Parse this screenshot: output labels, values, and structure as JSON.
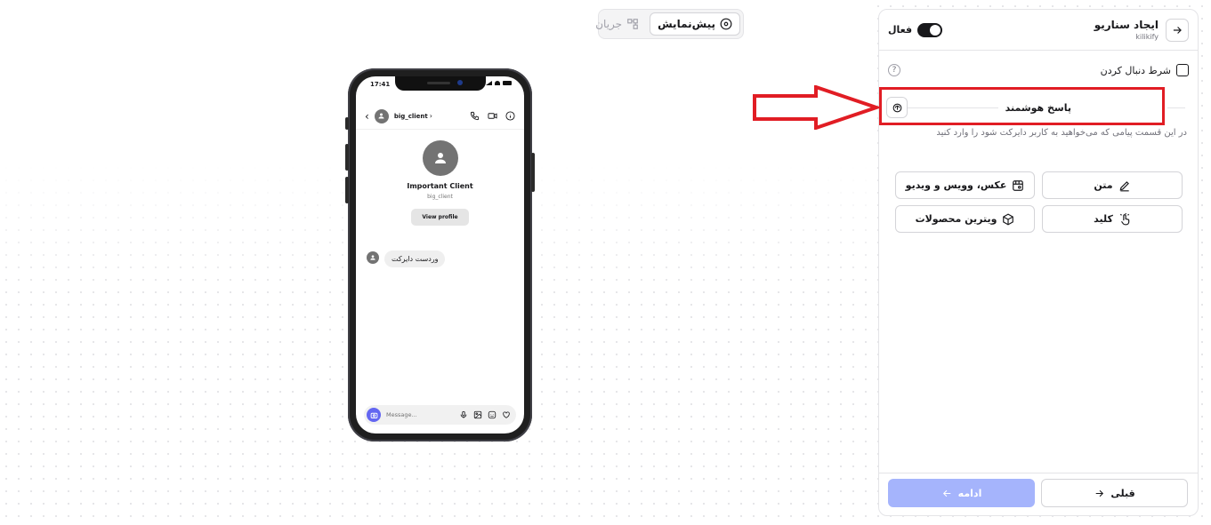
{
  "view_toggle": {
    "preview_label": "پیش‌نمایش",
    "flow_label": "جریان"
  },
  "phone": {
    "time": "17:41",
    "header_username": "big_client",
    "profile_name": "Important Client",
    "profile_username": "big_client",
    "view_profile_label": "View profile",
    "message_text": "وردست دایرکت",
    "composer_placeholder": "Message..."
  },
  "panel": {
    "title": "ایجاد سناریو",
    "subtitle": "kilikify",
    "active_label": "فعال",
    "follow_condition_label": "شرط دنبال کردن",
    "help_glyph": "?",
    "smart_reply_label": "پاسخ هوشمند",
    "description": "در این قسمت پیامی که می‌خواهید به کاربر دایرکت شود را وارد کنید",
    "options": {
      "text": "متن",
      "media": "عکس، وویس و ویدیو",
      "key": "کلید",
      "products": "ویترین محصولات"
    },
    "footer": {
      "prev_label": "قبلی",
      "next_label": "ادامه"
    }
  },
  "colors": {
    "annotation_red": "#e11d24",
    "primary_disabled": "#a5b4fc",
    "composer_camera": "#6366f1"
  }
}
